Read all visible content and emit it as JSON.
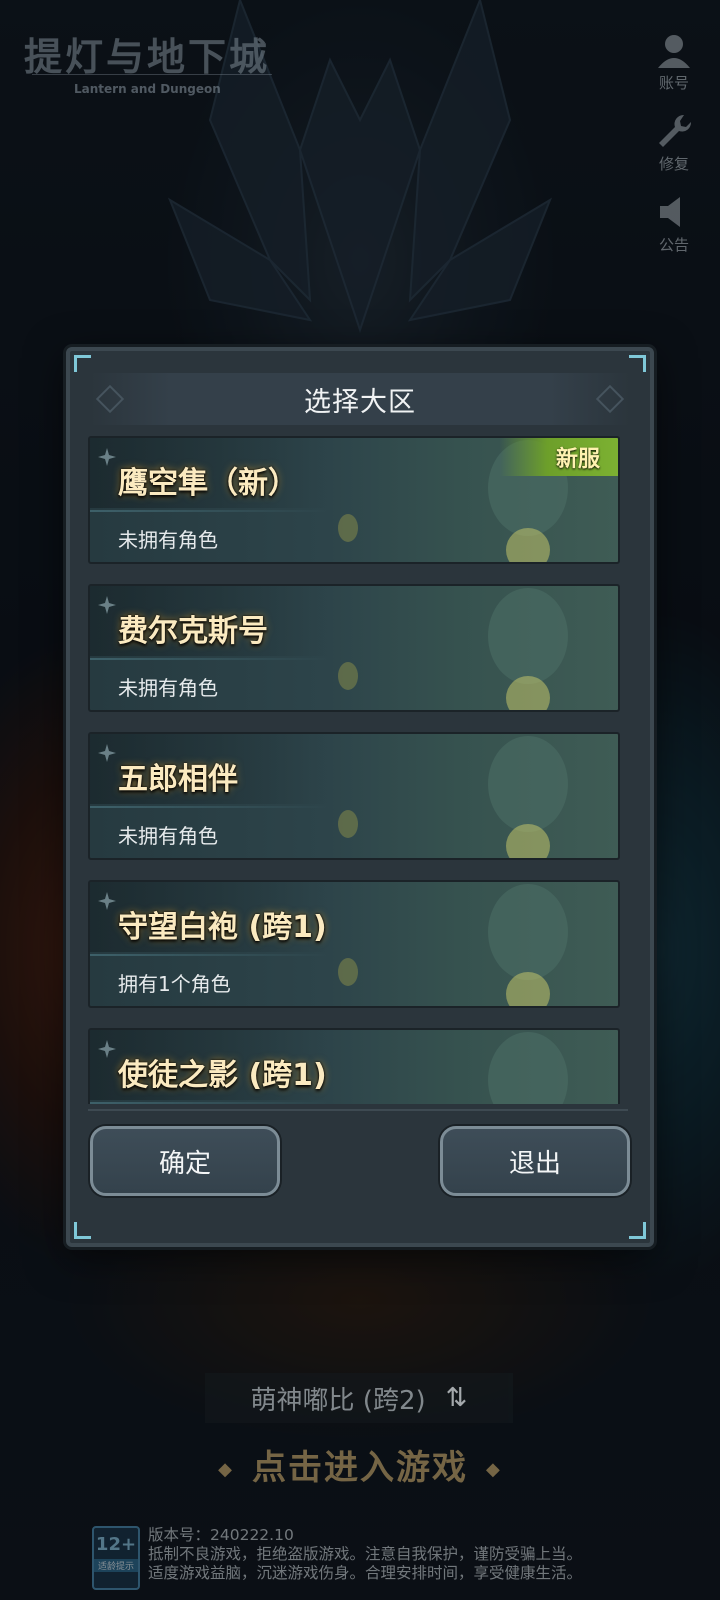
{
  "game": {
    "title_cn": "提灯与地下城",
    "title_en": "Lantern and Dungeon"
  },
  "side_menu": [
    {
      "icon": "account-icon",
      "label": "账号"
    },
    {
      "icon": "wrench-icon",
      "label": "修复"
    },
    {
      "icon": "speaker-icon",
      "label": "公告"
    }
  ],
  "dialog": {
    "title": "选择大区",
    "servers": [
      {
        "name": "鹰空隼（新）",
        "status": "未拥有角色",
        "badge": "新服"
      },
      {
        "name": "费尔克斯号",
        "status": "未拥有角色"
      },
      {
        "name": "五郎相伴",
        "status": "未拥有角色"
      },
      {
        "name": "守望白袍 (跨1)",
        "status": "拥有1个角色"
      },
      {
        "name": "使徒之影 (跨1)",
        "status": ""
      }
    ],
    "confirm_label": "确定",
    "exit_label": "退出"
  },
  "bottom": {
    "current_server": "萌神嘟比 (跨2)",
    "swap_icon": "⇅",
    "enter_label": "点击进入游戏",
    "age_rating": "12+",
    "age_tag": "适龄提示",
    "version": "版本号：240222.10",
    "notice_line1": "抵制不良游戏，拒绝盗版游戏。注意自我保护，谨防受骗上当。",
    "notice_line2": "适度游戏益脑，沉迷游戏伤身。合理安排时间，享受健康生活。"
  },
  "colors": {
    "server_name": "#fbeac0",
    "badge_new": "#7cb132",
    "dialog_bg": "#2b353c"
  }
}
